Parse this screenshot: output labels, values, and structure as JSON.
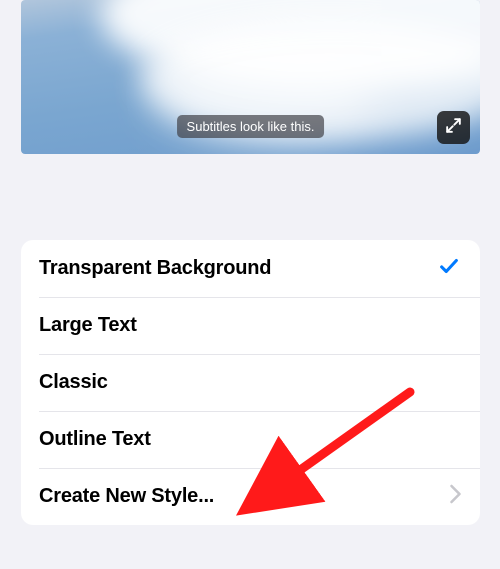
{
  "preview": {
    "subtitle_sample": "Subtitles look like this."
  },
  "styles": {
    "items": [
      {
        "label": "Transparent Background",
        "selected": true,
        "navigates": false
      },
      {
        "label": "Large Text",
        "selected": false,
        "navigates": false
      },
      {
        "label": "Classic",
        "selected": false,
        "navigates": false
      },
      {
        "label": "Outline Text",
        "selected": false,
        "navigates": false
      },
      {
        "label": "Create New Style...",
        "selected": false,
        "navigates": true
      }
    ]
  }
}
